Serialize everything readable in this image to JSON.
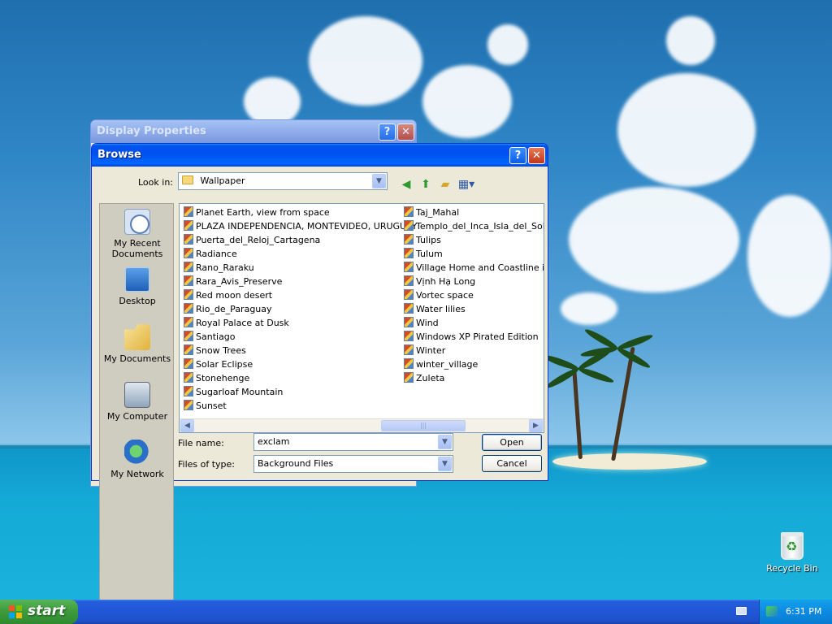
{
  "background_dialog": {
    "title": "Display Properties"
  },
  "browse_dialog": {
    "title": "Browse",
    "look_in_label": "Look in:",
    "look_in_value": "Wallpaper",
    "places": [
      {
        "label": "My Recent Documents",
        "icon": "recent-documents-icon"
      },
      {
        "label": "Desktop",
        "icon": "desktop-icon"
      },
      {
        "label": "My Documents",
        "icon": "my-documents-icon"
      },
      {
        "label": "My Computer",
        "icon": "my-computer-icon"
      },
      {
        "label": "My Network",
        "icon": "my-network-icon"
      }
    ],
    "files_col1": [
      "Planet Earth, view from space",
      "PLAZA INDEPENDENCIA, MONTEVIDEO, URUGUAY",
      "Puerta_del_Reloj_Cartagena",
      "Radiance",
      "Rano_Raraku",
      "Rara_Avis_Preserve",
      "Red moon desert",
      "Rio_de_Paraguay",
      "Royal Palace at Dusk",
      "Santiago",
      "Snow Trees",
      "Solar Eclipse",
      "Stonehenge",
      "Sugarloaf Mountain",
      "Sunset"
    ],
    "files_col2": [
      "Taj_Mahal",
      "Templo_del_Inca_Isla_del_Sol",
      "Tulips",
      "Tulum",
      "Village Home and Coastline in Gre",
      "Vịnh Hạ Long",
      "Vortec space",
      "Water lilies",
      "Wind",
      "Windows XP Pirated Edition",
      "Winter",
      "winter_village",
      "Zuleta"
    ],
    "file_name_label": "File name:",
    "file_name_value": "exclam",
    "file_type_label": "Files of type:",
    "file_type_value": "Background Files",
    "open_label": "Open",
    "cancel_label": "Cancel",
    "help_label": "?",
    "close_label": "✕"
  },
  "desktop": {
    "recycle_bin_label": "Recycle Bin"
  },
  "taskbar": {
    "start_label": "start",
    "clock": "6:31 PM"
  },
  "colors": {
    "titlebar_blue": "#0053ee",
    "start_green": "#3c9a3c",
    "dialog_face": "#ece9d8"
  }
}
